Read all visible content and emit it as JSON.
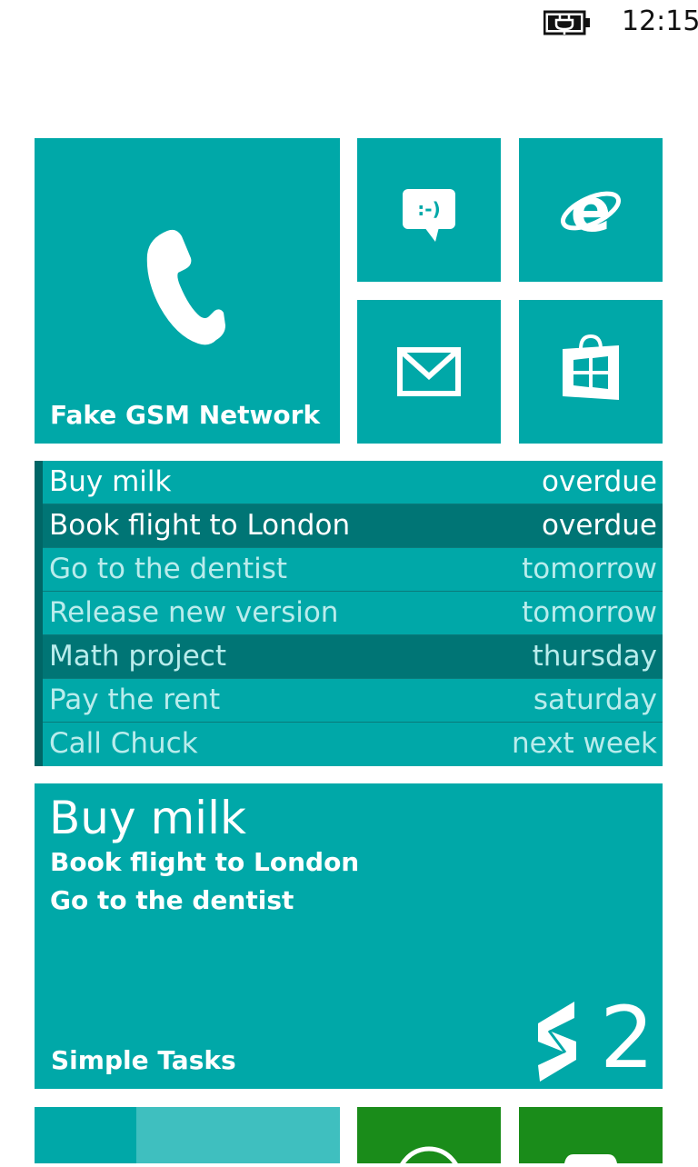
{
  "status_bar": {
    "time": "12:15",
    "battery_icon": "battery-charging-icon"
  },
  "tiles": {
    "phone": {
      "label": "Fake GSM Network",
      "icon": "phone-icon"
    },
    "messaging": {
      "icon": "messaging-icon",
      "glyph": ":-)"
    },
    "browser": {
      "icon": "internet-explorer-icon"
    },
    "mail": {
      "icon": "mail-icon"
    },
    "store": {
      "icon": "store-icon"
    }
  },
  "task_list": {
    "items": [
      {
        "name": "Buy milk",
        "due": "overdue"
      },
      {
        "name": "Book flight to London",
        "due": "overdue"
      },
      {
        "name": "Go to the dentist",
        "due": "tomorrow"
      },
      {
        "name": "Release new version",
        "due": "tomorrow"
      },
      {
        "name": "Math project",
        "due": "thursday"
      },
      {
        "name": "Pay the rent",
        "due": "saturday"
      },
      {
        "name": "Call Chuck",
        "due": "next week"
      }
    ]
  },
  "simple_tasks_tile": {
    "title": "Buy milk",
    "lines": [
      "Book flight to London",
      "Go to the dentist"
    ],
    "label": "Simple Tasks",
    "count": "2"
  },
  "colors": {
    "accent": "#00A8A8",
    "accent_dark": "#007575",
    "green_tile": "#1a8c1a"
  }
}
